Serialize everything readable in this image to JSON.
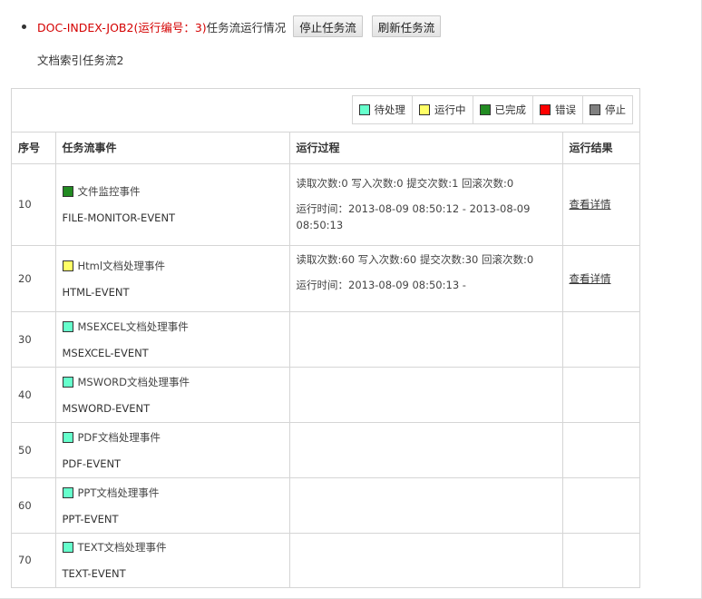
{
  "header": {
    "job_name": "DOC-INDEX-JOB2(运行编号：3)",
    "job_suffix": "任务流运行情况",
    "stop_button": "停止任务流",
    "refresh_button": "刷新任务流",
    "subtitle": "文档索引任务流2"
  },
  "legend": [
    {
      "label": "待处理",
      "color": "#66ffcc"
    },
    {
      "label": "运行中",
      "color": "#ffff66"
    },
    {
      "label": "已完成",
      "color": "#228B22"
    },
    {
      "label": "错误",
      "color": "#ff0000"
    },
    {
      "label": "停止",
      "color": "#808080"
    }
  ],
  "table": {
    "headers": {
      "seq": "序号",
      "event": "任务流事件",
      "process": "运行过程",
      "result": "运行结果"
    },
    "rows": [
      {
        "seq": "10",
        "name": "文件监控事件",
        "code": "FILE-MONITOR-EVENT",
        "status_color": "#228B22",
        "proc1": "读取次数:0 写入次数:0 提交次数:1 回滚次数:0",
        "proc2": "运行时间：2013-08-09 08:50:12 - 2013-08-09",
        "proc3": "08:50:13",
        "result": "查看详情"
      },
      {
        "seq": "20",
        "name": "Html文档处理事件",
        "code": "HTML-EVENT",
        "status_color": "#ffff66",
        "proc1": "读取次数:60 写入次数:60 提交次数:30 回滚次数:0",
        "proc2": "运行时间：2013-08-09 08:50:13 -",
        "proc3": "",
        "result": "查看详情"
      },
      {
        "seq": "30",
        "name": "MSEXCEL文档处理事件",
        "code": "MSEXCEL-EVENT",
        "status_color": "#66ffcc"
      },
      {
        "seq": "40",
        "name": "MSWORD文档处理事件",
        "code": "MSWORD-EVENT",
        "status_color": "#66ffcc"
      },
      {
        "seq": "50",
        "name": "PDF文档处理事件",
        "code": "PDF-EVENT",
        "status_color": "#66ffcc"
      },
      {
        "seq": "60",
        "name": "PPT文档处理事件",
        "code": "PPT-EVENT",
        "status_color": "#66ffcc"
      },
      {
        "seq": "70",
        "name": "TEXT文档处理事件",
        "code": "TEXT-EVENT",
        "status_color": "#66ffcc"
      }
    ]
  }
}
